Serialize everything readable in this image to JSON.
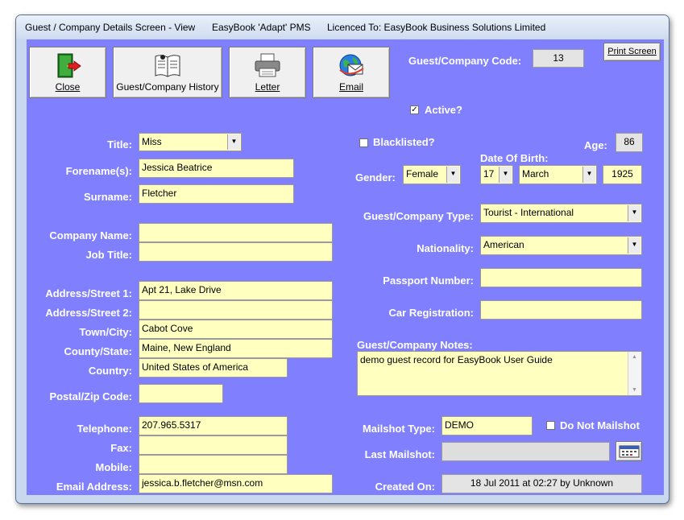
{
  "titlebar": {
    "screen": "Guest / Company Details Screen - View",
    "app": "EasyBook 'Adapt' PMS",
    "licence": "Licenced To: EasyBook Business Solutions Limited"
  },
  "toolbar": {
    "close": "Close",
    "history": "Guest/Company History",
    "letter": "Letter",
    "email": "Email",
    "print": "Print Screen"
  },
  "code": {
    "label": "Guest/Company Code:",
    "value": "13"
  },
  "active": {
    "label": "Active?",
    "checked": true
  },
  "blacklisted": {
    "label": "Blacklisted?",
    "checked": false
  },
  "age": {
    "label": "Age:",
    "value": "86"
  },
  "dob": {
    "label": "Date Of Birth:",
    "day": "17",
    "month": "March",
    "year": "1925"
  },
  "gender": {
    "label": "Gender:",
    "value": "Female"
  },
  "left": {
    "title_label": "Title:",
    "title": "Miss",
    "forename_label": "Forename(s):",
    "forename": "Jessica Beatrice",
    "surname_label": "Surname:",
    "surname": "Fletcher",
    "company_label": "Company Name:",
    "company": "",
    "job_label": "Job Title:",
    "job": "",
    "addr1_label": "Address/Street 1:",
    "addr1": "Apt 21, Lake Drive",
    "addr2_label": "Address/Street 2:",
    "addr2": "",
    "town_label": "Town/City:",
    "town": "Cabot Cove",
    "county_label": "County/State:",
    "county": "Maine, New England",
    "country_label": "Country:",
    "country": "United States of America",
    "postal_label": "Postal/Zip Code:",
    "postal": "",
    "tel_label": "Telephone:",
    "tel": "207.965.5317",
    "fax_label": "Fax:",
    "fax": "",
    "mobile_label": "Mobile:",
    "mobile": "",
    "email_label": "Email Address:",
    "email": "jessica.b.fletcher@msn.com"
  },
  "right": {
    "type_label": "Guest/Company Type:",
    "type": "Tourist - International",
    "nat_label": "Nationality:",
    "nat": "American",
    "passport_label": "Passport Number:",
    "passport": "",
    "car_label": "Car Registration:",
    "car": "",
    "notes_label": "Guest/Company Notes:",
    "notes": "demo guest record for EasyBook User Guide",
    "mailshot_label": "Mailshot Type:",
    "mailshot": "DEMO",
    "nomail_label": "Do Not Mailshot",
    "nomail_checked": false,
    "lastmail_label": "Last Mailshot:",
    "lastmail": "",
    "created_label": "Created On:",
    "created": "18 Jul 2011 at 02:27 by Unknown"
  },
  "colors": {
    "panel": "#8080ff",
    "field": "#ffffc0",
    "label": "#ffffff"
  }
}
